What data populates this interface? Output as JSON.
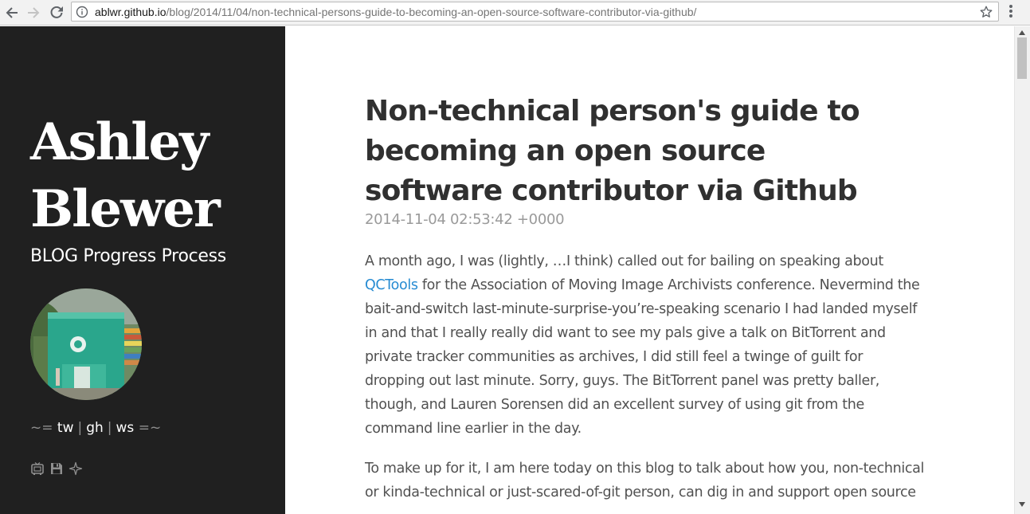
{
  "browser": {
    "url_host": "ablwr.github.io",
    "url_path": "/blog/2014/11/04/non-technical-persons-guide-to-becoming-an-open-source-software-contributor-via-github/"
  },
  "sidebar": {
    "title_line1": "Ashley",
    "title_line2": "Blewer",
    "tagline": "BLOG Progress Process",
    "social": {
      "prefix": "~=",
      "links": [
        "tw",
        "gh",
        "ws"
      ],
      "suffix": "=~"
    },
    "icons": [
      "tv-icon",
      "floppy-disk-icon",
      "sparkle-icon"
    ]
  },
  "post": {
    "title": "Non-technical person's guide to becoming an open source software contributor via Github",
    "date": "2014-11-04 02:53:42 +0000",
    "para1_link": "QCTools",
    "para1_lines": [
      "A month ago, I was (lightly, …I think) called out for bailing on speaking about",
      " for the Association of Moving Image Archivists conference. Nevermind the",
      "bait-and-switch last-minute-surprise-you’re-speaking scenario I had landed myself",
      "in and that I really really did want to see my pals give a talk on BitTorrent and",
      "private tracker communities as archives, I did still feel a twinge of guilt for",
      "dropping out last minute. Sorry, guys. The BitTorrent panel was pretty baller,",
      "though, and Lauren Sorensen did an excellent survey of using git from the",
      "command line earlier in the day."
    ],
    "para2_lines": [
      "To make up for it, I am here today on this blog to talk about how you, non-technical",
      "or kinda-technical or just-scared-of-git person, can dig in and support open source"
    ]
  },
  "colors": {
    "sidebar_bg": "#202020",
    "link": "#268bd2",
    "body_text": "#515151"
  }
}
